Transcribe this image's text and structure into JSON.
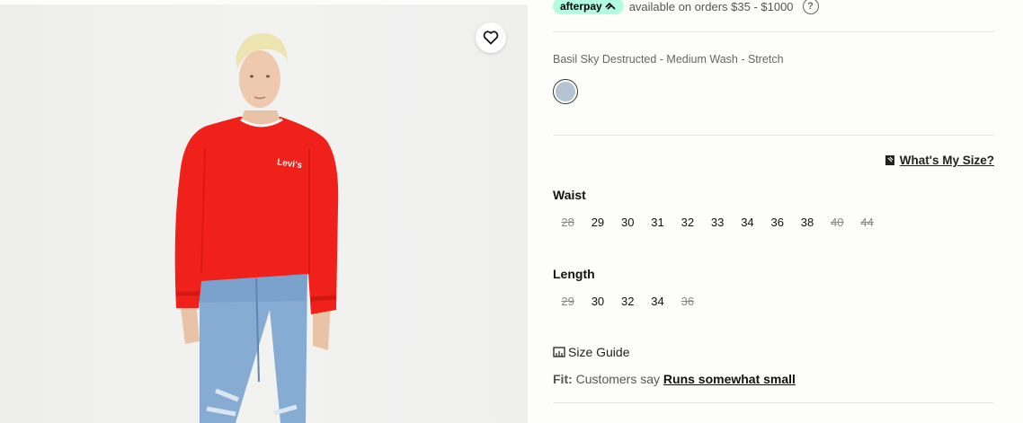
{
  "afterpay": {
    "brand": "afterpay",
    "text": "available on orders $35 - $1000",
    "help": "?"
  },
  "color": {
    "name": "Basil Sky Destructed - Medium Wash - Stretch",
    "swatch": "#b4c4d2"
  },
  "size_help": {
    "label": "What's My Size?"
  },
  "waist": {
    "title": "Waist",
    "sizes": [
      {
        "label": "28",
        "available": false
      },
      {
        "label": "29",
        "available": true
      },
      {
        "label": "30",
        "available": true
      },
      {
        "label": "31",
        "available": true
      },
      {
        "label": "32",
        "available": true
      },
      {
        "label": "33",
        "available": true
      },
      {
        "label": "34",
        "available": true
      },
      {
        "label": "36",
        "available": true
      },
      {
        "label": "38",
        "available": true
      },
      {
        "label": "40",
        "available": false
      },
      {
        "label": "44",
        "available": false
      }
    ]
  },
  "length": {
    "title": "Length",
    "sizes": [
      {
        "label": "29",
        "available": false
      },
      {
        "label": "30",
        "available": true
      },
      {
        "label": "32",
        "available": true
      },
      {
        "label": "34",
        "available": true
      },
      {
        "label": "36",
        "available": false
      }
    ]
  },
  "size_guide": {
    "label": "Size Guide"
  },
  "fit": {
    "label": "Fit:",
    "prefix": "Customers say",
    "value": "Runs somewhat small"
  },
  "image": {
    "logo": "Levi's",
    "shirt_color": "#f0201a",
    "jeans_color": "#8fb3d8"
  }
}
